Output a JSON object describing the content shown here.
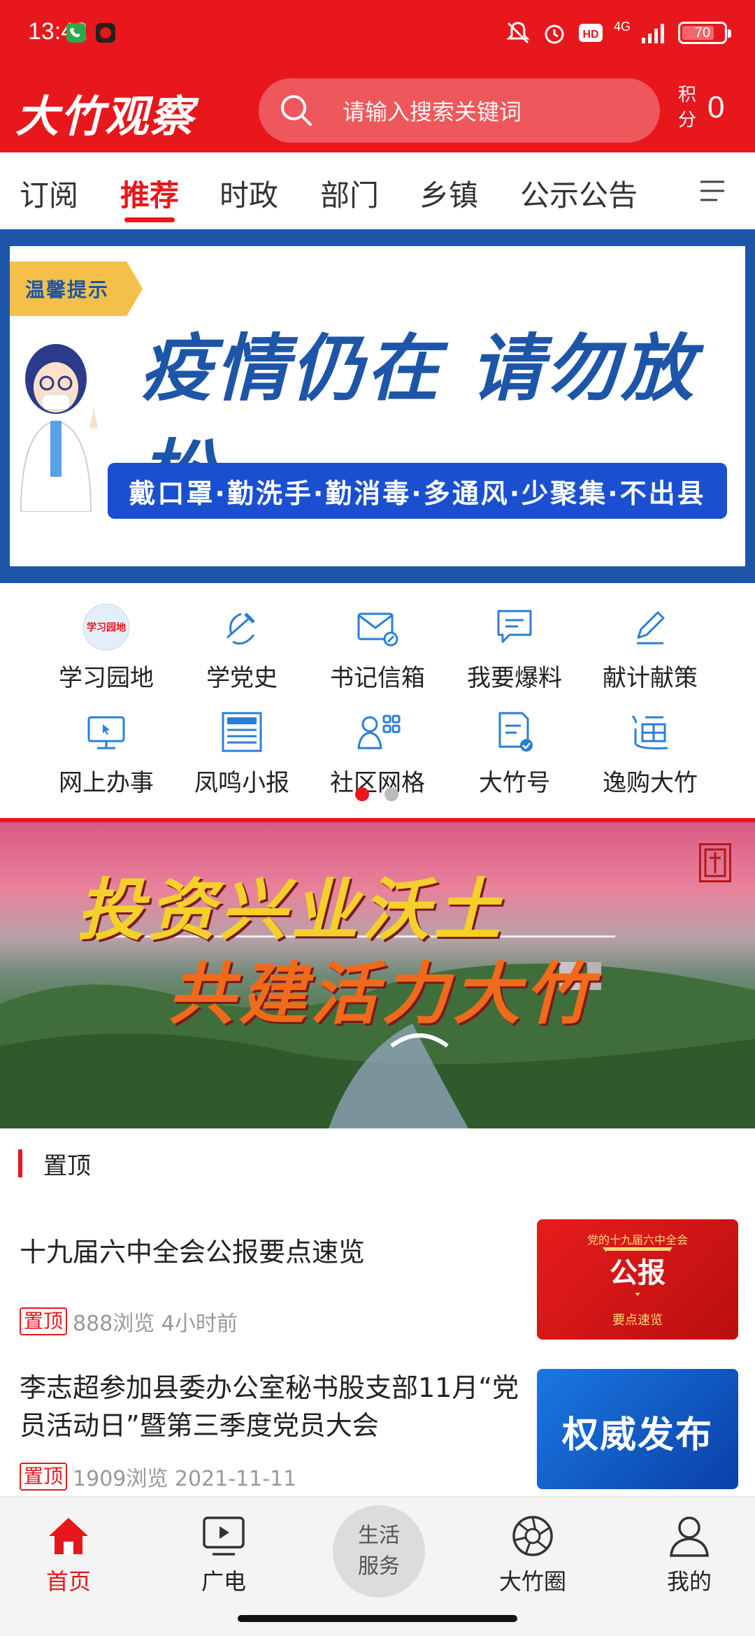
{
  "status_bar": {
    "time": "13:42",
    "network": "4G",
    "battery": "70"
  },
  "header": {
    "logo": "大竹观察",
    "search_placeholder": "请输入搜索关键词",
    "points_label": "积分",
    "points_value": "0"
  },
  "tabs": [
    "订阅",
    "推荐",
    "时政",
    "部门",
    "乡镇",
    "公示公告"
  ],
  "banner1": {
    "tag": "温馨提示",
    "title": "疫情仍在 请勿放松",
    "subtitle": "戴口罩·勤洗手·勤消毒·多通风·少聚集·不出县"
  },
  "quick_menu": [
    {
      "label": "学习园地",
      "icon": "study-garden-icon"
    },
    {
      "label": "学党史",
      "icon": "hammer-sickle-icon"
    },
    {
      "label": "书记信箱",
      "icon": "mail-icon"
    },
    {
      "label": "我要爆料",
      "icon": "chat-icon"
    },
    {
      "label": "献计献策",
      "icon": "pencil-icon"
    },
    {
      "label": "网上办事",
      "icon": "monitor-icon"
    },
    {
      "label": "凤鸣小报",
      "icon": "newspaper-icon"
    },
    {
      "label": "社区网格",
      "icon": "community-grid-icon"
    },
    {
      "label": "大竹号",
      "icon": "verified-doc-icon"
    },
    {
      "label": "逸购大竹",
      "icon": "shop-icon"
    }
  ],
  "quick_menu_study_badge": "学习园地",
  "banner2": {
    "line1": "投资兴业沃土",
    "line2": "共建活力大竹"
  },
  "pinned": {
    "section_title": "置顶",
    "items": [
      {
        "title": "十九届六中全会公报要点速览",
        "tag": "置顶",
        "info": "888浏览 4小时前",
        "thumb_top": "党的十九届六中全会",
        "thumb_big": "公报",
        "thumb_bottom": "要点速览"
      },
      {
        "title": "李志超参加县委办公室秘书股支部11月“党员活动日”暨第三季度党员大会",
        "tag": "置顶",
        "info": "1909浏览 2021-11-11",
        "thumb_big": "权威发布"
      }
    ]
  },
  "bottom_nav": [
    {
      "label": "首页",
      "icon": "home-icon"
    },
    {
      "label": "广电",
      "icon": "tv-play-icon"
    },
    {
      "label": "生活服务",
      "icon": ""
    },
    {
      "label": "大竹圈",
      "icon": "aperture-icon"
    },
    {
      "label": "我的",
      "icon": "user-icon"
    }
  ],
  "colors": {
    "brand_red": "#e8171c",
    "banner_blue": "#1d55a8"
  }
}
